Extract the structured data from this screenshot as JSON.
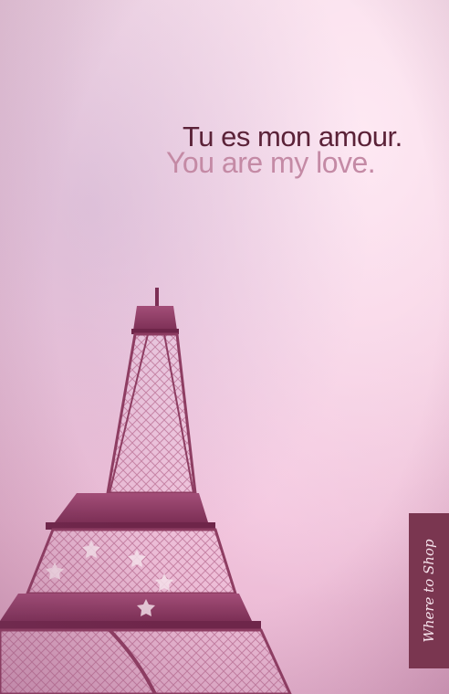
{
  "headline": {
    "french": "Tu es mon amour.",
    "english": "You are my love."
  },
  "shop_tab": {
    "label": "Where to Shop"
  },
  "colors": {
    "background": "#f2c9dd",
    "headline_dark": "#5b2238",
    "headline_light": "#c48aa5",
    "tab_background": "#7a3650",
    "tower": "#8e3d62"
  },
  "image": {
    "subject": "eiffel-tower-illustration"
  }
}
